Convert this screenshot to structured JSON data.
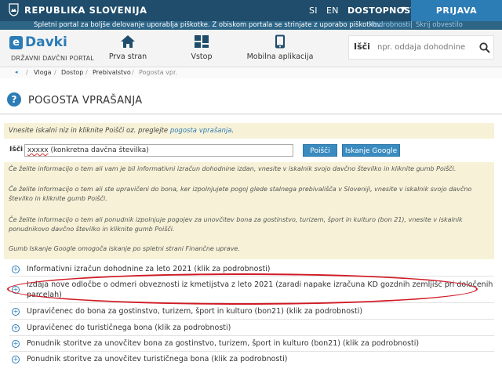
{
  "topbar": {
    "country": "REPUBLIKA SLOVENIJA",
    "lang_si": "SI",
    "lang_en": "EN",
    "accessibility": "DOSTOPNOST",
    "login": "PRIJAVA"
  },
  "cookie": {
    "text": "Spletni portal za boljše delovanje uporablja piškotke. Z obiskom portala se strinjate z uporabo piškotkov.",
    "details": "Podrobnosti",
    "separator": "|",
    "hide": "Skrij obvestilo"
  },
  "header": {
    "logo": "Davki",
    "logo_letter": "e",
    "subtitle": "DRŽAVNI DAVČNI PORTAL",
    "nav": {
      "home": "Prva stran",
      "login": "Vstop",
      "mobile": "Mobilna aplikacija"
    },
    "search_label": "Išči",
    "search_placeholder": "npr. oddaja dohodnine"
  },
  "breadcrumb": {
    "back": "◂",
    "items": [
      "Vloga",
      "Dostop",
      "Prebivalstvo"
    ],
    "separator": "/",
    "current": "Pogosta vpr."
  },
  "page": {
    "title": "POGOSTA VPRAŠANJA"
  },
  "intro": {
    "text": "Vnesite iskalni niz in kliknite Poišči oz. preglejte ",
    "link": "pogosta vprašanja",
    "end": "."
  },
  "query": {
    "label": "Išči",
    "value_marked": "xxxxx",
    "value_rest": " (konkretna davčna številka)",
    "search_button": "Poišči",
    "google_button": "Iskanje Google"
  },
  "help": [
    "Če želite informacijo o tem ali vam je bil informativni izračun dohodnine izdan, vnesite v iskalnik svojo davčno številko in kliknite gumb Poišči.",
    "Če želite informacijo o tem ali ste upravičeni do bona, ker izpolnjujete pogoj glede stalnega prebivališča v Sloveniji, vnesite v iskalnik svojo davčno številko in kliknite gumb Poišči.",
    "Če želite informacijo o tem ali ponudnik izpolnjuje pogojev za unovčitev bona za gostinstvo, turizem, šport in kulturo (bon 21), vnesite v iskalnik ponudnikovo davčno številko in kliknite gumb Poišči.",
    "Gumb Iskanje Google omogoča iskanje po spletni strani Finančne uprave."
  ],
  "results": [
    {
      "line1": "Informativni izračun dohodnine za leto 2021 (klik za podrobnosti)",
      "line2": ""
    },
    {
      "line1": "Izdaja nove odločbe o odmeri obveznosti iz kmetijstva z leto 2021 (zaradi napake izračuna KD gozdnih zemljišč pri določenih",
      "line2": "parcelah)"
    },
    {
      "line1": "Upravičenec do bona za gostinstvo, turizem, šport in kulturo (bon21) (klik za podrobnosti)",
      "line2": ""
    },
    {
      "line1": "Upravičenec do turističnega bona (klik za podrobnosti)",
      "line2": ""
    },
    {
      "line1": "Ponudnik storitve za unovčitev bona za gostinstvo, turizem, šport in kulturo (bon21) (klik za podrobnosti)",
      "line2": ""
    },
    {
      "line1": "Ponudnik storitve za unovčitev turističnega bona (klik za podrobnosti)",
      "line2": ""
    }
  ],
  "colors": {
    "topbar": "#1f4d6b",
    "accent": "#2c7cb6",
    "highlight_box": "#f7f2d7",
    "annotation": "#d01a25"
  }
}
